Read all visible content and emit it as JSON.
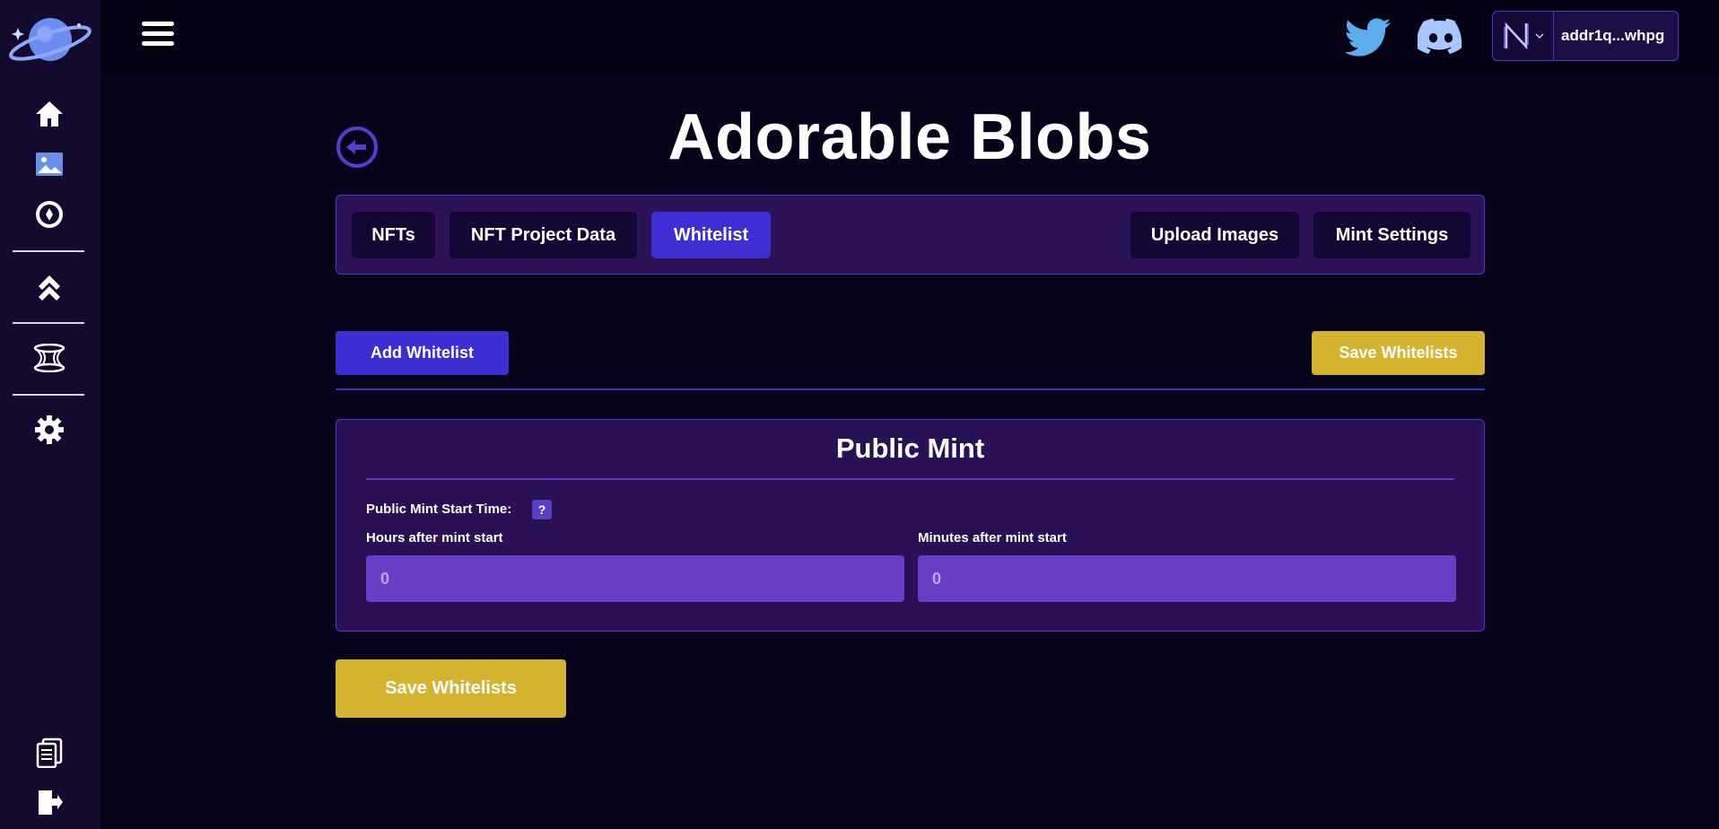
{
  "sidebar": {
    "items": [
      {
        "icon": "home-icon"
      },
      {
        "icon": "image-icon"
      },
      {
        "icon": "compass-icon"
      },
      {
        "icon": "chevrons-up-icon"
      },
      {
        "icon": "wormhole-icon"
      },
      {
        "icon": "gear-icon"
      },
      {
        "icon": "documents-icon"
      },
      {
        "icon": "logout-icon"
      }
    ]
  },
  "header": {
    "wallet_address": "addr1q...whpg",
    "social": [
      "twitter-icon",
      "discord-icon"
    ]
  },
  "page": {
    "title": "Adorable Blobs"
  },
  "tabs": [
    {
      "label": "NFTs",
      "active": false
    },
    {
      "label": "NFT Project Data",
      "active": false
    },
    {
      "label": "Whitelist",
      "active": true
    },
    {
      "label": "Upload Images",
      "active": false
    },
    {
      "label": "Mint Settings",
      "active": false
    }
  ],
  "actions": {
    "add_whitelist": "Add Whitelist",
    "save_whitelists": "Save Whitelists"
  },
  "public_mint": {
    "title": "Public Mint",
    "start_time_label": "Public Mint Start Time:",
    "help": "?",
    "hours_label": "Hours after mint start",
    "hours_placeholder": "0",
    "minutes_label": "Minutes after mint start",
    "minutes_placeholder": "0"
  },
  "colors": {
    "accent": "#3c2fd2",
    "save": "#d4b32e",
    "card": "#2a1155",
    "input": "#673fc6"
  }
}
